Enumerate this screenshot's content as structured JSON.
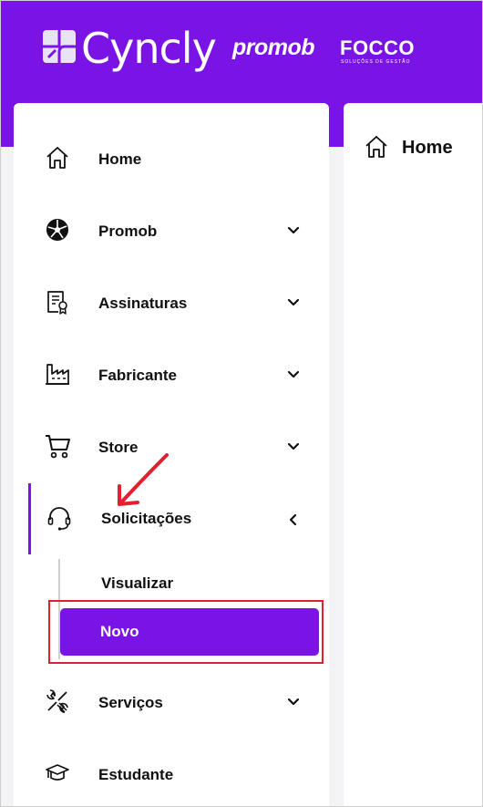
{
  "header": {
    "brand_cyncly": "Cyncly",
    "brand_promob": "promob",
    "brand_focco": "FOCCO",
    "brand_focco_tagline": "SOLUÇÕES DE GESTÃO",
    "background_color": "#7a14e6"
  },
  "sidebar": {
    "items": [
      {
        "label": "Home",
        "icon": "home-icon",
        "expandable": false
      },
      {
        "label": "Promob",
        "icon": "promob-icon",
        "expandable": true,
        "expanded": false
      },
      {
        "label": "Assinaturas",
        "icon": "certificate-icon",
        "expandable": true,
        "expanded": false
      },
      {
        "label": "Fabricante",
        "icon": "factory-icon",
        "expandable": true,
        "expanded": false
      },
      {
        "label": "Store",
        "icon": "cart-icon",
        "expandable": true,
        "expanded": false
      },
      {
        "label": "Solicitações",
        "icon": "headset-icon",
        "expandable": true,
        "expanded": true,
        "active": true
      },
      {
        "label": "Serviços",
        "icon": "tools-icon",
        "expandable": true,
        "expanded": false
      },
      {
        "label": "Estudante",
        "icon": "graduation-cap-icon",
        "expandable": false
      }
    ],
    "submenu": [
      {
        "label": "Visualizar",
        "selected": false
      },
      {
        "label": "Novo",
        "selected": true
      }
    ],
    "accent_color": "#7a14e6"
  },
  "content": {
    "title": "Home",
    "icon": "home-icon"
  },
  "annotation": {
    "color": "#e2202e"
  }
}
